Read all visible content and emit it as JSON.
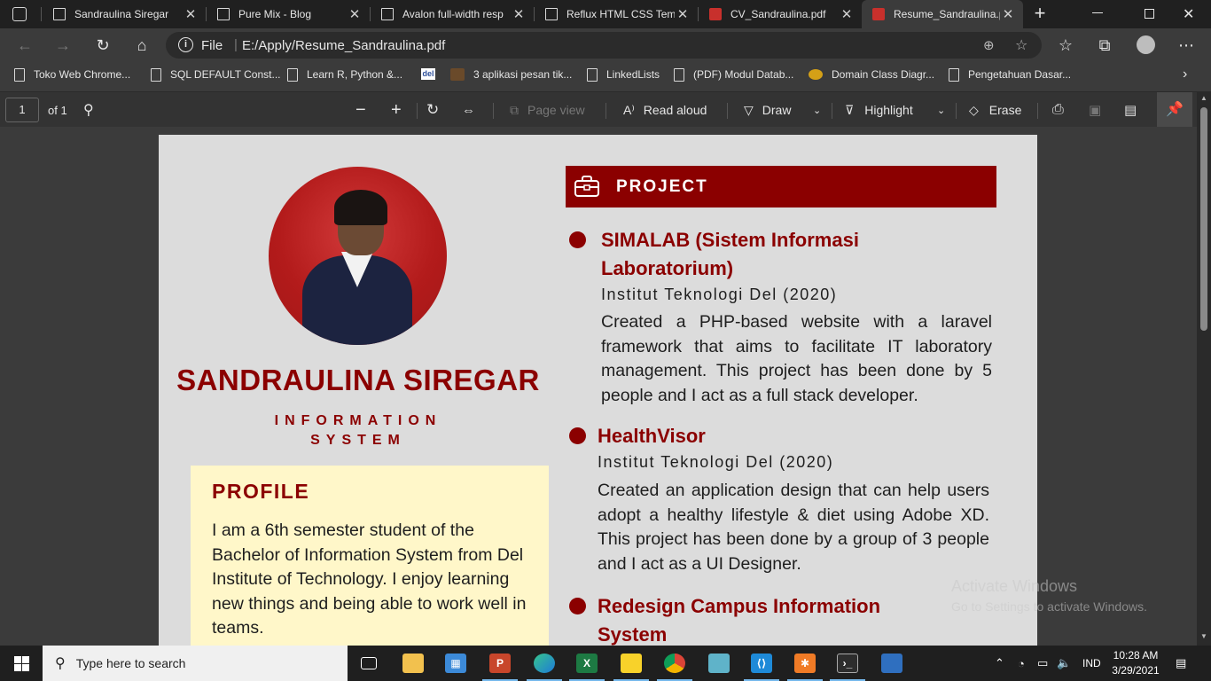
{
  "tabs": [
    {
      "title": "Sandraulina Siregar",
      "icon": "page-icon"
    },
    {
      "title": "Pure Mix - Blog",
      "icon": "page-icon"
    },
    {
      "title": "Avalon full-width resp",
      "icon": "page-icon"
    },
    {
      "title": "Reflux HTML CSS Tem",
      "icon": "page-icon"
    },
    {
      "title": "CV_Sandraulina.pdf",
      "icon": "pdf-icon"
    },
    {
      "title": "Resume_Sandraulina.p",
      "icon": "pdf-icon"
    }
  ],
  "address": {
    "scheme": "File",
    "url": "E:/Apply/Resume_Sandraulina.pdf"
  },
  "bookmarks": [
    "Toko Web Chrome...",
    "SQL DEFAULT Const...",
    "Learn R, Python &...",
    "3 aplikasi pesan tik...",
    "LinkedLists",
    "(PDF) Modul Datab...",
    "Domain Class Diagr...",
    "Pengetahuan Dasar..."
  ],
  "pdf_toolbar": {
    "page_number": "1",
    "page_total": "of 1",
    "page_view": "Page view",
    "read_aloud": "Read aloud",
    "draw": "Draw",
    "highlight": "Highlight",
    "erase": "Erase"
  },
  "resume": {
    "name": "SANDRAULINA SIREGAR",
    "major_line1": "INFORMATION",
    "major_line2": "SYSTEM",
    "profile_title": "PROFILE",
    "profile_text": "I am a 6th semester student of the Bachelor of Information System from Del Institute of Technology. I enjoy learning new things and being able to work well in teams.",
    "project_title": "PROJECT",
    "projects": [
      {
        "title": "SIMALAB (Sistem Informasi Laboratorium)",
        "org": "Institut Teknologi Del (2020)",
        "desc": "Created a PHP-based website with a laravel framework that aims to facilitate IT laboratory management. This project has been done by 5 people and I act as a full stack developer."
      },
      {
        "title": "HealthVisor",
        "org": "Institut Teknologi Del (2020)",
        "desc": "Created an application design that can help users adopt a healthy lifestyle & diet using Adobe XD. This project has been done by a group of 3 people and I act as a UI Designer."
      },
      {
        "title": "Redesign Campus Information System",
        "org": "",
        "desc": ""
      }
    ]
  },
  "watermark": {
    "line1": "Activate Windows",
    "line2": "Go to Settings to activate Windows."
  },
  "taskbar": {
    "search_placeholder": "Type here to search",
    "language": "IND",
    "time": "10:28 AM",
    "date": "3/29/2021"
  },
  "colors": {
    "accent": "#8b0000",
    "profile_bg": "#fff7c9",
    "page_bg": "#dcdcdc"
  }
}
